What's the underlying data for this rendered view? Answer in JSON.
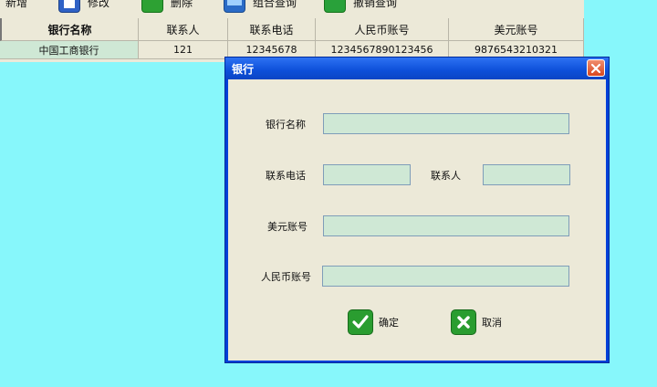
{
  "toolbar": {
    "items": [
      {
        "label": "新增",
        "icon": "add-icon"
      },
      {
        "label": "修改",
        "icon": "edit-icon"
      },
      {
        "label": "删除",
        "icon": "delete-icon"
      },
      {
        "label": "组合查询",
        "icon": "combined-query-icon"
      },
      {
        "label": "撤销查询",
        "icon": "undo-query-icon"
      }
    ]
  },
  "grid": {
    "columns": [
      "银行名称",
      "联系人",
      "联系电话",
      "人民币账号",
      "美元账号"
    ],
    "rows": [
      [
        "中国工商银行",
        "121",
        "12345678",
        "1234567890123456",
        "9876543210321"
      ]
    ]
  },
  "dialog": {
    "title": "银行",
    "labels": {
      "bank_name": "银行名称",
      "phone": "联系电话",
      "contact": "联系人",
      "usd_account": "美元账号",
      "rmb_account": "人民币账号"
    },
    "values": {
      "bank_name": "",
      "phone": "",
      "contact": "",
      "usd_account": "",
      "rmb_account": ""
    },
    "ok_label": "确定",
    "cancel_label": "取消"
  },
  "colors": {
    "desktop": "#87f7fb",
    "dialog_frame": "#0040d8",
    "field_bg": "#cfe8d5",
    "button_green": "#2a9d30",
    "close_red": "#d8471f"
  }
}
